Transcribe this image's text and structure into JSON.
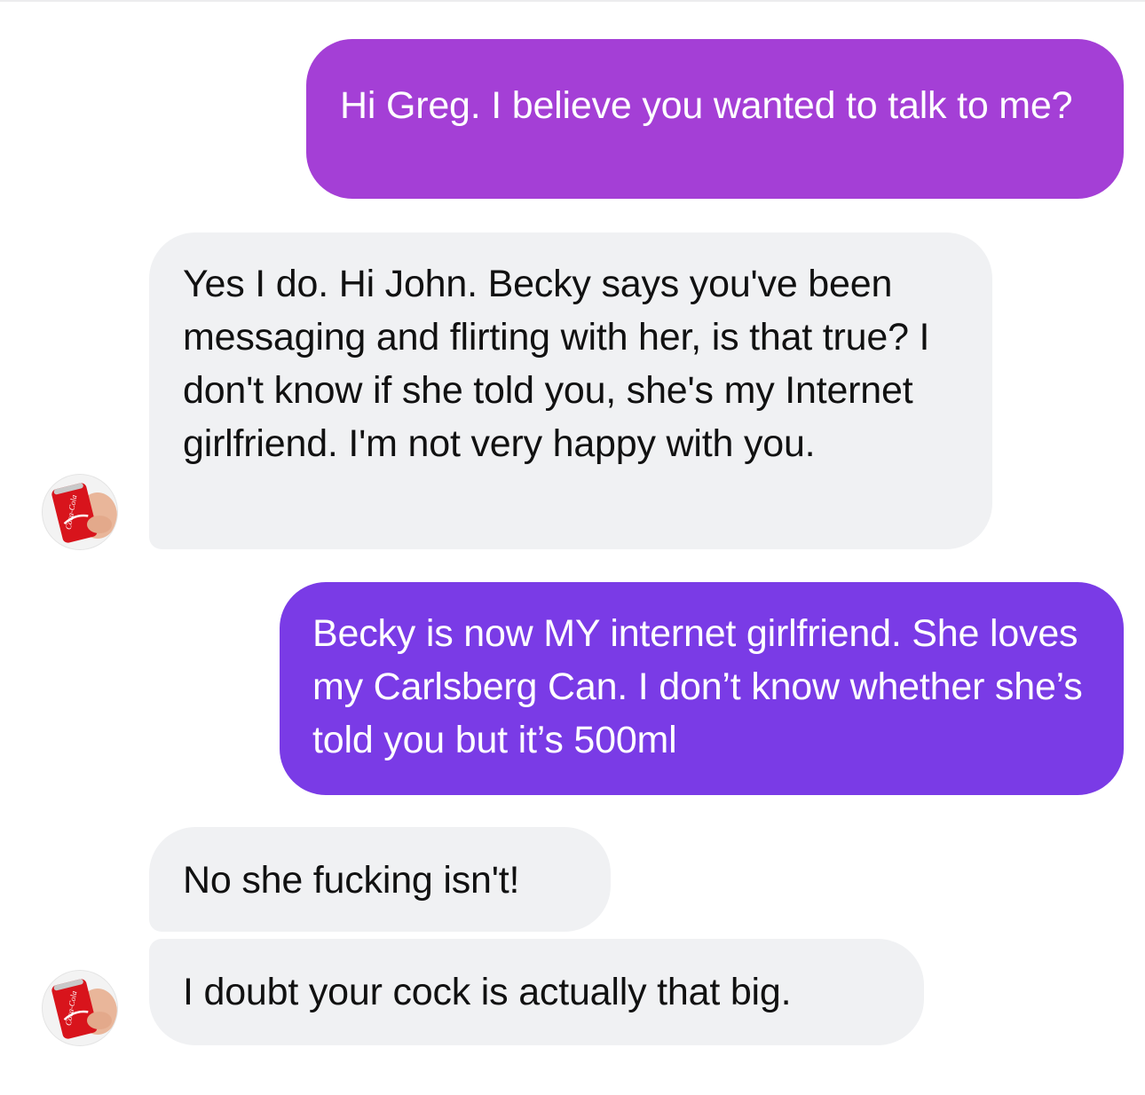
{
  "thread": {
    "messages": [
      {
        "sender": "self",
        "text": "Hi Greg. I believe you wanted to talk to me?"
      },
      {
        "sender": "other",
        "text": "Yes I do. Hi John. Becky says you've been messaging and flirting with her, is that true? I don't know if she told you, she's my Internet girlfriend. I'm not very happy with you."
      },
      {
        "sender": "self",
        "text": "Becky is now MY internet girlfriend. She loves my Carlsberg Can. I don’t know whether she’s told you but it’s 500ml"
      },
      {
        "sender": "other",
        "text": "No she fucking isn't!"
      },
      {
        "sender": "other",
        "text": "I doubt your cock is actually that big."
      }
    ]
  },
  "avatar": {
    "icon": "coca-cola-can-in-hand-icon",
    "can_text": "Coca-Cola"
  },
  "colors": {
    "outgoing_bubble_top": "#a43fd6",
    "outgoing_bubble_bottom": "#7a3be6",
    "incoming_bubble": "#f0f1f3",
    "incoming_text": "#111111",
    "outgoing_text": "#ffffff",
    "can_red": "#d8141c"
  }
}
